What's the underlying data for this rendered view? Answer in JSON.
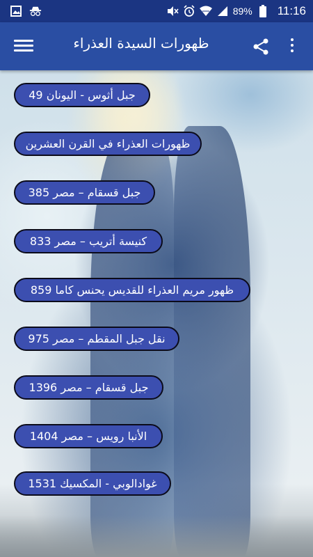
{
  "status_bar": {
    "battery_percent": "89%",
    "time": "11:16",
    "icons": [
      "image-icon",
      "incognito-icon",
      "mute-icon",
      "alarm-icon",
      "wifi-icon",
      "signal-icon",
      "battery-icon"
    ]
  },
  "app_bar": {
    "title": "ظهورات السيدة العذراء",
    "icons": [
      "menu-icon",
      "share-icon",
      "more-vert-icon"
    ]
  },
  "items": [
    "جبل أثوس - اليونان 49",
    "ظهورات العذراء في القرن العشرين",
    "جبل قسقام – مصر 385",
    "كنيسة أتريب – مصر 833",
    "ظهور مريم العذراء للقديس يحنس كاما 859",
    "نقل جبل المقطم – مصر 975",
    "جبل قسقام – مصر 1396",
    "الأنبا رويس – مصر 1404",
    "غوادالوبي - المكسيك 1531"
  ],
  "colors": {
    "status_bar": "#1b3582",
    "app_bar": "#2a4ea3",
    "item_button": "#3c4fb0"
  }
}
